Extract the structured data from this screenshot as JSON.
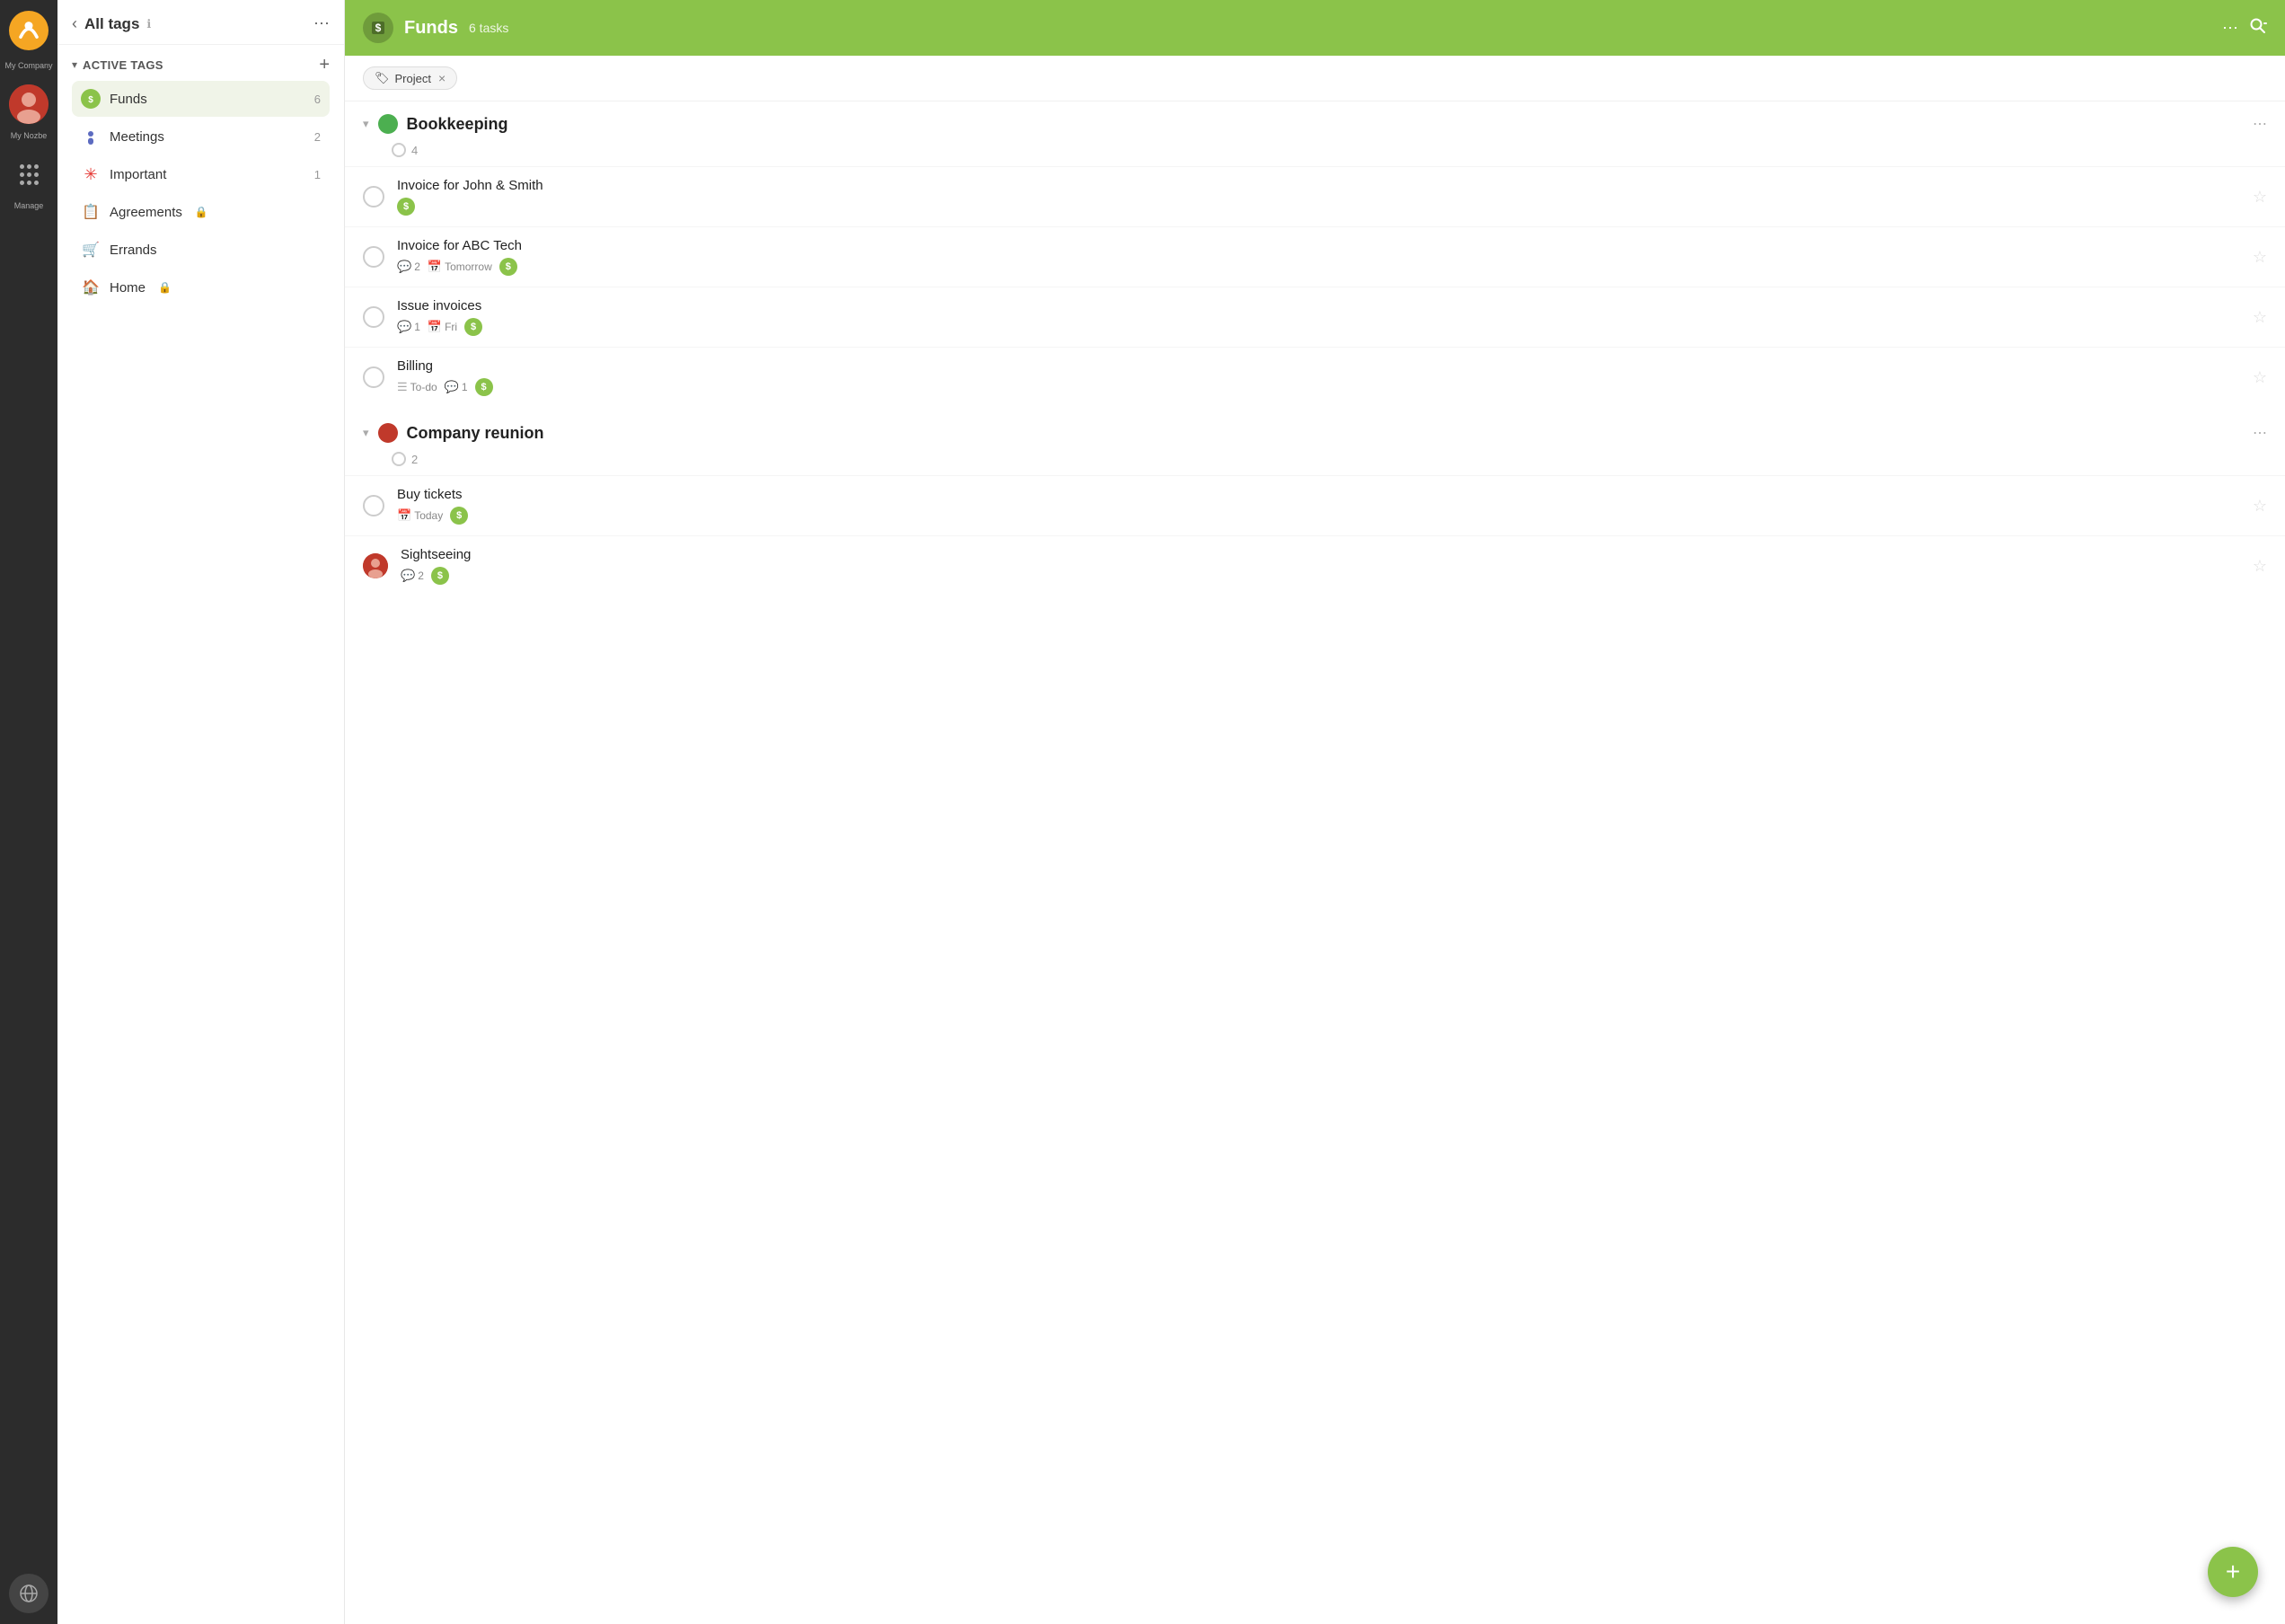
{
  "app": {
    "company": "My Company",
    "user_label": "My Nozbe"
  },
  "sidebar": {
    "title": "All tags",
    "back_label": "‹",
    "more_label": "⋯",
    "active_tags_label": "Active tags",
    "add_label": "+",
    "tags": [
      {
        "id": "funds",
        "name": "Funds",
        "icon_type": "funds",
        "icon_char": "$",
        "count": 6,
        "active": true
      },
      {
        "id": "meetings",
        "name": "Meetings",
        "icon_type": "meetings",
        "icon_char": "🎤",
        "count": 2,
        "active": false
      },
      {
        "id": "important",
        "name": "Important",
        "icon_type": "important",
        "icon_char": "✳",
        "count": 1,
        "active": false
      },
      {
        "id": "agreements",
        "name": "Agreements",
        "icon_type": "agreements",
        "icon_char": "📋",
        "count": null,
        "active": false,
        "locked": true
      },
      {
        "id": "errands",
        "name": "Errands",
        "icon_type": "errands",
        "icon_char": "🛒",
        "count": null,
        "active": false
      },
      {
        "id": "home",
        "name": "Home",
        "icon_type": "home",
        "icon_char": "🏠",
        "count": null,
        "active": false,
        "locked": true
      }
    ]
  },
  "main": {
    "header": {
      "title": "Funds",
      "tasks_label": "6 tasks",
      "more_label": "⋯",
      "accent_color": "#8bc34a"
    },
    "filter": {
      "chip_icon": "🏷",
      "chip_label": "Project",
      "chip_close": "×"
    },
    "projects": [
      {
        "name": "Bookkeeping",
        "color": "#4caf50",
        "task_count": 4,
        "tasks": [
          {
            "title": "Invoice for John & Smith",
            "meta": [
              {
                "type": "tag-s"
              }
            ]
          },
          {
            "title": "Invoice for ABC Tech",
            "meta": [
              {
                "type": "comment",
                "value": "2"
              },
              {
                "type": "date",
                "value": "Tomorrow"
              },
              {
                "type": "tag-s"
              }
            ]
          },
          {
            "title": "Issue invoices",
            "meta": [
              {
                "type": "comment",
                "value": "1"
              },
              {
                "type": "date",
                "value": "Fri"
              },
              {
                "type": "tag-s"
              }
            ]
          },
          {
            "title": "Billing",
            "meta": [
              {
                "type": "list",
                "value": "To-do"
              },
              {
                "type": "comment",
                "value": "1"
              },
              {
                "type": "tag-s"
              }
            ]
          }
        ]
      },
      {
        "name": "Company reunion",
        "color": "#c0392b",
        "task_count": 2,
        "tasks": [
          {
            "title": "Buy tickets",
            "meta": [
              {
                "type": "date",
                "value": "Today"
              },
              {
                "type": "tag-s"
              }
            ],
            "avatar": null
          },
          {
            "title": "Sightseeing",
            "meta": [
              {
                "type": "comment",
                "value": "2"
              },
              {
                "type": "tag-s"
              }
            ],
            "avatar": true
          }
        ]
      }
    ],
    "fab_label": "+"
  },
  "icons": {
    "comment": "💬",
    "calendar": "📅",
    "list": "☰",
    "star": "☆",
    "star_filled": "★",
    "lock": "🔒",
    "search": "🔍"
  }
}
